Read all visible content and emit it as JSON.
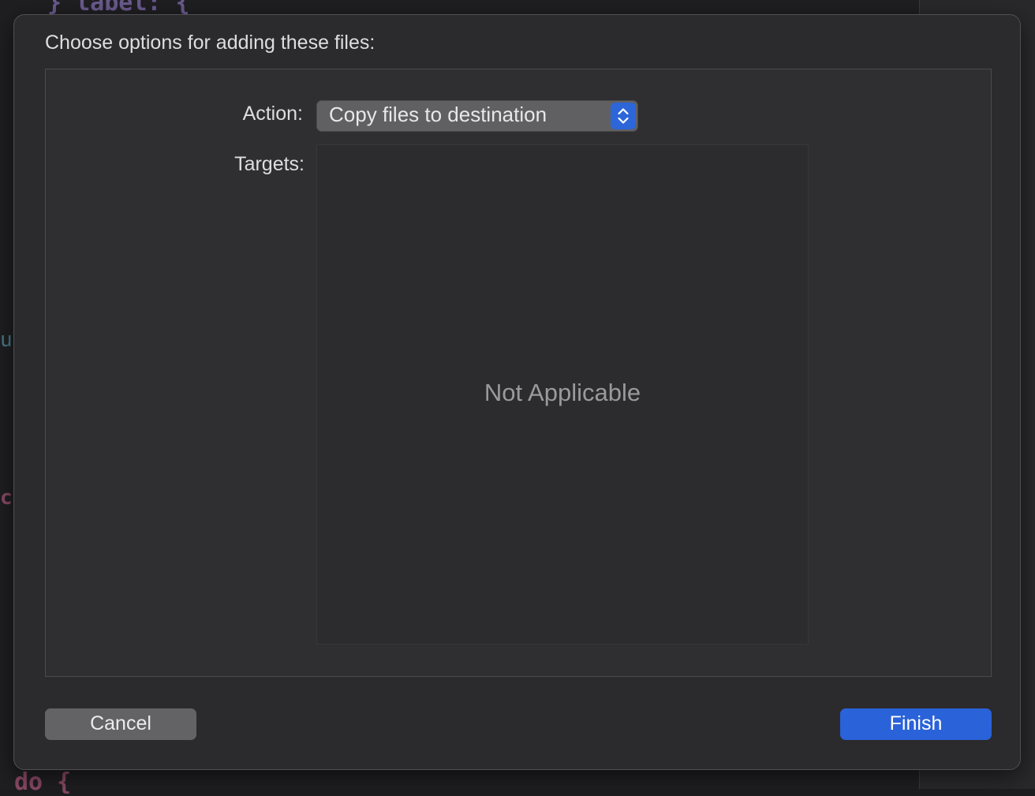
{
  "dialog": {
    "title": "Choose options for adding these files:",
    "action_label": "Action:",
    "action_value": "Copy files to destination",
    "targets_label": "Targets:",
    "targets_placeholder": "Not Applicable",
    "cancel_label": "Cancel",
    "finish_label": "Finish"
  },
  "background_code": {
    "top_line": "} label: {",
    "left_frag_1": "u",
    "left_frag_2": "c",
    "bottom_line": "do {"
  },
  "colors": {
    "accent": "#2a62d9",
    "sheet_bg": "#2b2b2d"
  }
}
